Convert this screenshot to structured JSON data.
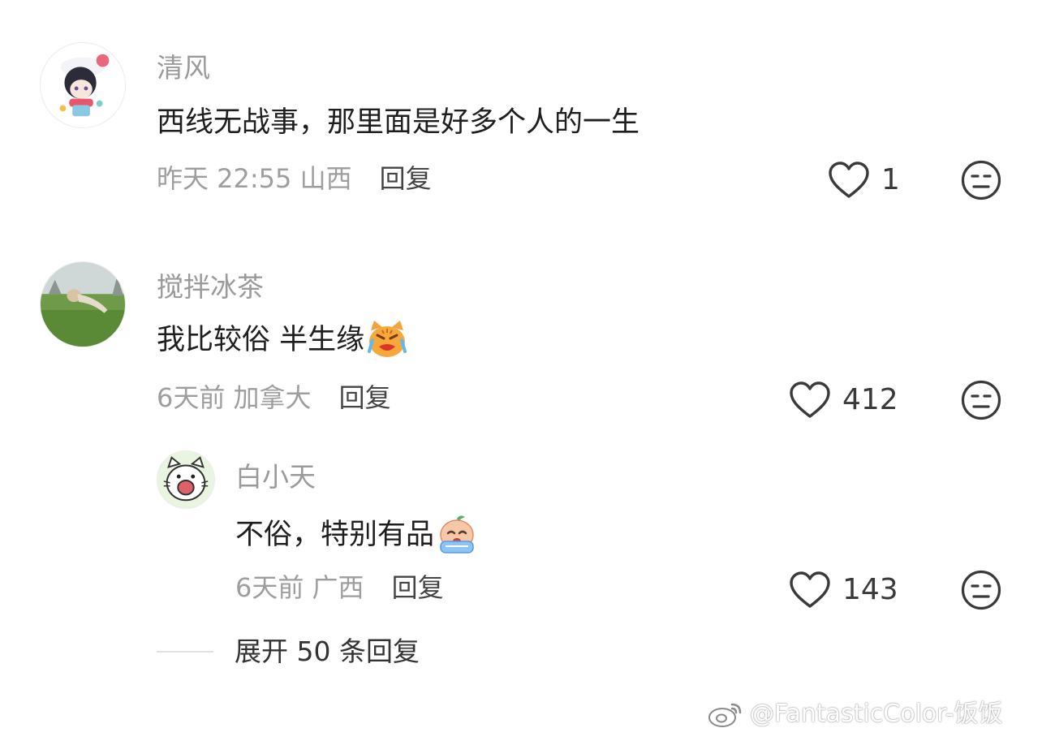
{
  "comments": [
    {
      "username": "清风",
      "text": "西线无战事，那里面是好多个人的一生",
      "time": "昨天 22:55",
      "location": "山西",
      "reply_label": "回复",
      "likes": "1"
    },
    {
      "username": "搅拌冰茶",
      "text": "我比较俗 半生缘",
      "emoji": "crying-cat-emoji",
      "time": "6天前",
      "location": "加拿大",
      "reply_label": "回复",
      "likes": "412"
    },
    {
      "username": "白小天",
      "text": "不俗，特别有品",
      "emoji": "crying-face-emoji",
      "time": "6天前",
      "location": "广西",
      "reply_label": "回复",
      "likes": "143",
      "is_reply": true
    }
  ],
  "expand_label": "展开 50 条回复",
  "watermark": "@FantasticColor-饭饭",
  "colors": {
    "muted": "#9e9e9e",
    "text": "#1e1e1e",
    "icon": "#3a3a3a"
  }
}
